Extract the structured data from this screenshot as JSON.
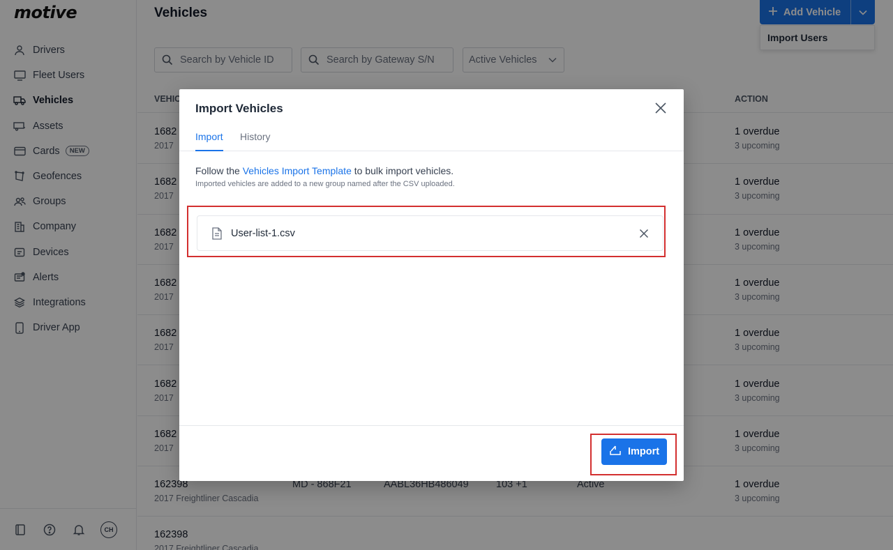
{
  "app": {
    "logo": "motive"
  },
  "sidebar": {
    "items": [
      {
        "label": "Drivers",
        "icon": "user-icon"
      },
      {
        "label": "Fleet Users",
        "icon": "monitor-icon"
      },
      {
        "label": "Vehicles",
        "icon": "truck-icon",
        "active": true
      },
      {
        "label": "Assets",
        "icon": "trailer-icon"
      },
      {
        "label": "Cards",
        "icon": "card-icon",
        "badge": "NEW"
      },
      {
        "label": "Geofences",
        "icon": "geofence-icon"
      },
      {
        "label": "Groups",
        "icon": "groups-icon"
      },
      {
        "label": "Company",
        "icon": "building-icon"
      },
      {
        "label": "Devices",
        "icon": "device-icon"
      },
      {
        "label": "Alerts",
        "icon": "alert-icon"
      },
      {
        "label": "Integrations",
        "icon": "layers-icon"
      },
      {
        "label": "Driver App",
        "icon": "phone-icon"
      }
    ],
    "footer": {
      "avatar_initials": "CH"
    }
  },
  "main": {
    "title": "Vehicles",
    "add_vehicle_label": "Add Vehicle",
    "dropdown_item": "Import Users",
    "filters": {
      "vehicle_id_placeholder": "Search by Vehicle ID",
      "gateway_placeholder": "Search by Gateway S/N",
      "status_select": "Active Vehicles"
    },
    "table": {
      "header_vehicle": "VEHIC",
      "header_action": "ACTION",
      "rows": [
        {
          "id": "1682",
          "desc": "2017",
          "overdue": "1 overdue",
          "upcoming": "3 upcoming"
        },
        {
          "id": "1682",
          "desc": "2017",
          "overdue": "1 overdue",
          "upcoming": "3 upcoming"
        },
        {
          "id": "1682",
          "desc": "2017",
          "overdue": "1 overdue",
          "upcoming": "3 upcoming"
        },
        {
          "id": "1682",
          "desc": "2017",
          "overdue": "1 overdue",
          "upcoming": "3 upcoming"
        },
        {
          "id": "1682",
          "desc": "2017",
          "overdue": "1 overdue",
          "upcoming": "3 upcoming"
        },
        {
          "id": "1682",
          "desc": "2017",
          "overdue": "1 overdue",
          "upcoming": "3 upcoming"
        },
        {
          "id": "1682",
          "desc": "2017",
          "overdue": "1 overdue",
          "upcoming": "3 upcoming"
        },
        {
          "id": "162398",
          "desc": "2017 Freightliner Cascadia",
          "plate": "MD - 868F21",
          "vin": "AABL36HB486049",
          "count": "103 +1",
          "status": "Active",
          "overdue": "1 overdue",
          "upcoming": "3 upcoming"
        },
        {
          "id": "162398",
          "desc": "2017 Freightliner Cascadia"
        }
      ]
    }
  },
  "modal": {
    "title": "Import Vehicles",
    "tabs": [
      "Import",
      "History"
    ],
    "instruction_prefix": "Follow the ",
    "template_link": "Vehicles Import Template",
    "instruction_suffix": " to bulk import vehicles.",
    "subnote": "Imported vehicles are added to a new group named after the CSV uploaded.",
    "file_name": "User-list-1.csv",
    "import_button": "Import"
  },
  "colors": {
    "accent": "#1a73e8",
    "highlight": "#d32f2f"
  }
}
